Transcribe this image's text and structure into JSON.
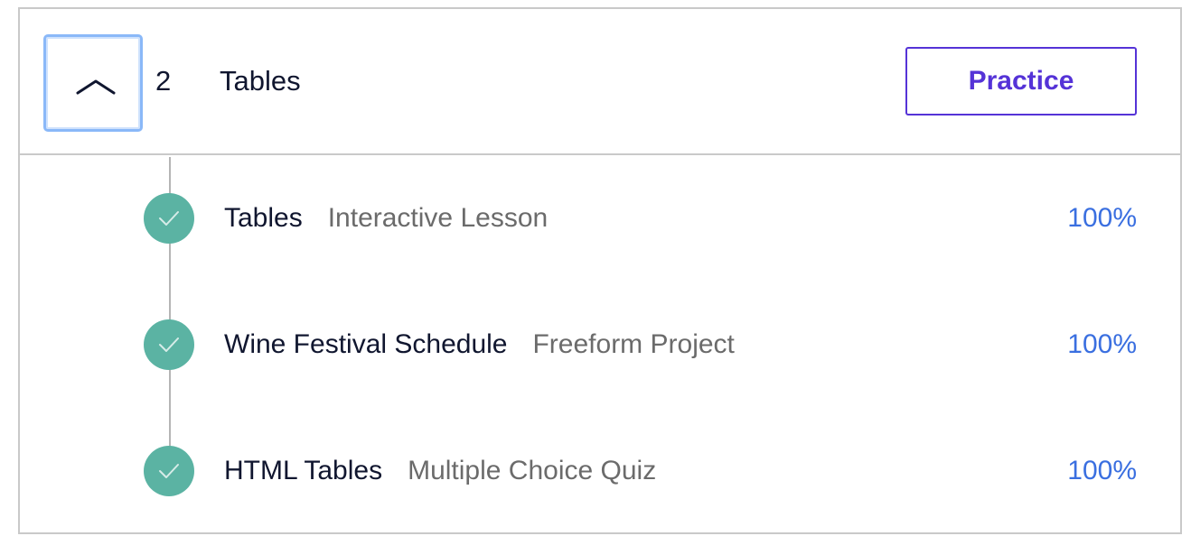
{
  "unit": {
    "number": "2",
    "title": "Tables",
    "practice_label": "Practice",
    "expanded": true
  },
  "lessons": [
    {
      "title": "Tables",
      "type": "Interactive Lesson",
      "progress": "100%",
      "completed": true
    },
    {
      "title": "Wine Festival Schedule",
      "type": "Freeform Project",
      "progress": "100%",
      "completed": true
    },
    {
      "title": "HTML Tables",
      "type": "Multiple Choice Quiz",
      "progress": "100%",
      "completed": true
    }
  ],
  "colors": {
    "accent_purple": "#5533d7",
    "progress_blue": "#3a6fe0",
    "check_green": "#5bb3a3",
    "focus_blue": "#8ab8f8"
  },
  "icons": {
    "toggle": "chevron-up-icon",
    "completed": "checkmark-icon"
  }
}
